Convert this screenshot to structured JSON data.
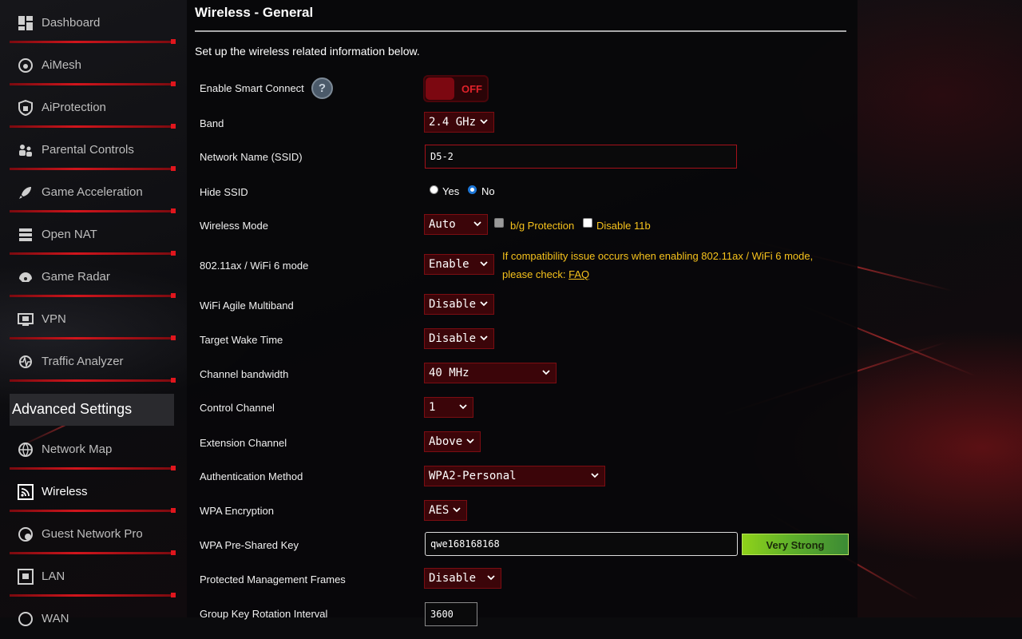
{
  "sidebar": {
    "items": [
      {
        "label": "Dashboard",
        "icon": "dashboard-icon"
      },
      {
        "label": "AiMesh",
        "icon": "aimesh-icon"
      },
      {
        "label": "AiProtection",
        "icon": "shield-icon"
      },
      {
        "label": "Parental Controls",
        "icon": "parental-controls-icon"
      },
      {
        "label": "Game Acceleration",
        "icon": "rocket-icon"
      },
      {
        "label": "Open NAT",
        "icon": "open-nat-icon"
      },
      {
        "label": "Game Radar",
        "icon": "radar-icon"
      },
      {
        "label": "VPN",
        "icon": "vpn-icon"
      },
      {
        "label": "Traffic Analyzer",
        "icon": "traffic-analyzer-icon"
      }
    ],
    "advanced_header": "Advanced Settings",
    "advanced_items": [
      {
        "label": "Network Map",
        "icon": "network-map-icon"
      },
      {
        "label": "Wireless",
        "icon": "wireless-icon"
      },
      {
        "label": "Guest Network Pro",
        "icon": "guest-network-icon"
      },
      {
        "label": "LAN",
        "icon": "lan-icon"
      },
      {
        "label": "WAN",
        "icon": "wan-icon"
      }
    ],
    "active": "Wireless"
  },
  "main": {
    "title": "Wireless - General",
    "intro": "Set up the wireless related information below.",
    "smart_connect": {
      "label": "Enable Smart Connect",
      "state": "OFF"
    },
    "band": {
      "label": "Band",
      "value": "2.4 GHz"
    },
    "ssid": {
      "label": "Network Name (SSID)",
      "value": "D5-2"
    },
    "hide_ssid": {
      "label": "Hide SSID",
      "yes": "Yes",
      "no": "No",
      "selected": "No"
    },
    "wireless_mode": {
      "label": "Wireless Mode",
      "value": "Auto",
      "bg_protection": "b/g Protection",
      "disable_11b": "Disable 11b"
    },
    "wifi6": {
      "label": "802.11ax / WiFi 6 mode",
      "value": "Enable",
      "note1": "If compatibility issue occurs when enabling 802.11ax / WiFi 6 mode,",
      "note2": "please check: ",
      "faq": "FAQ"
    },
    "agile": {
      "label": "WiFi Agile Multiband",
      "value": "Disable"
    },
    "twt": {
      "label": "Target Wake Time",
      "value": "Disable"
    },
    "bandwidth": {
      "label": "Channel bandwidth",
      "value": "40 MHz"
    },
    "control_channel": {
      "label": "Control Channel",
      "value": "1"
    },
    "extension_channel": {
      "label": "Extension Channel",
      "value": "Above"
    },
    "auth": {
      "label": "Authentication Method",
      "value": "WPA2-Personal"
    },
    "encryption": {
      "label": "WPA Encryption",
      "value": "AES"
    },
    "psk": {
      "label": "WPA Pre-Shared Key",
      "value": "qwe168168168",
      "strength": "Very Strong"
    },
    "pmf": {
      "label": "Protected Management Frames",
      "value": "Disable"
    },
    "gkri": {
      "label": "Group Key Rotation Interval",
      "value": "3600"
    }
  },
  "colors": {
    "accent_red": "#d0151c",
    "warning_yellow": "#f6c21c",
    "strength_green": "#8fd21a"
  }
}
